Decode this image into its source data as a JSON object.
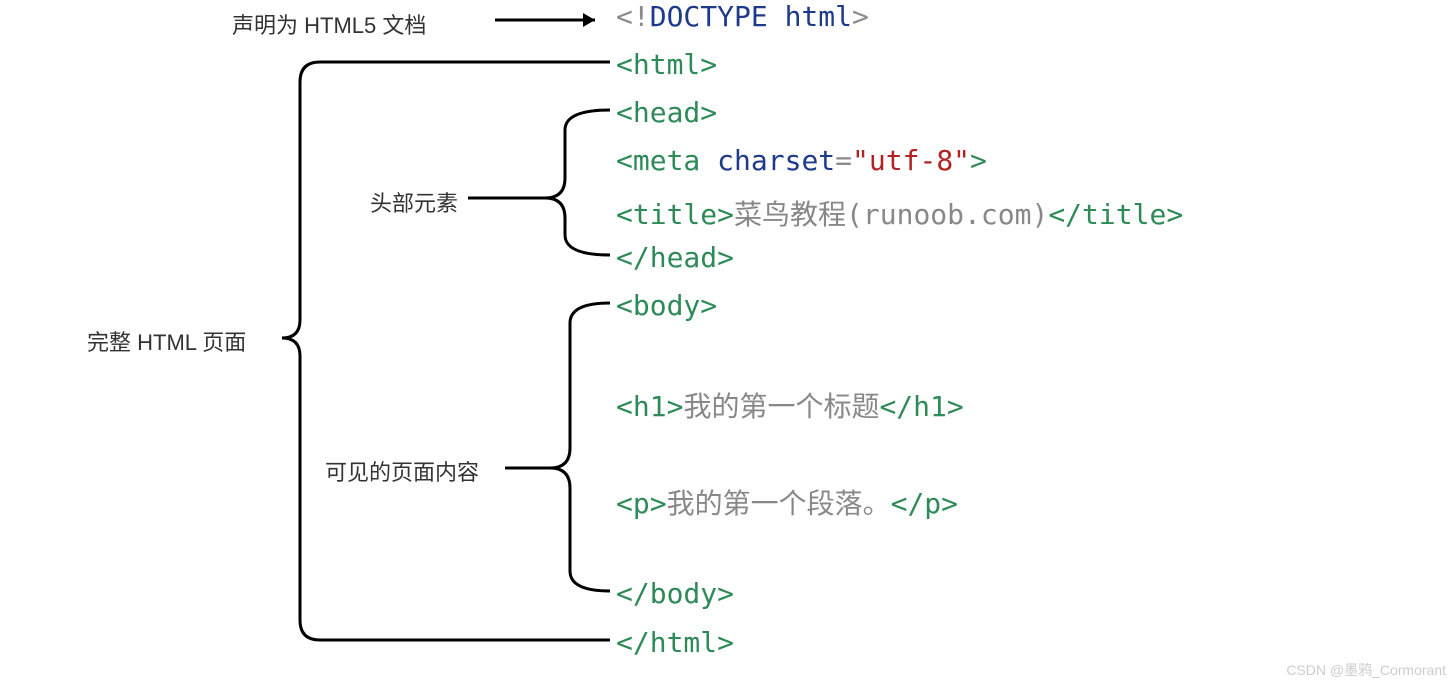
{
  "labels": {
    "doctype": "声明为 HTML5 文档",
    "fullPage": "完整 HTML 页面",
    "headSection": "头部元素",
    "bodySection": "可见的页面内容"
  },
  "code": {
    "doctype": {
      "open": "<",
      "bang": "!",
      "kw": "DOCTYPE html",
      "close": ">"
    },
    "htmlOpen": "<html>",
    "headOpen": "<head>",
    "meta": {
      "open": "<meta ",
      "attrName": "charset",
      "eq": "=",
      "attrVal": "\"utf-8\"",
      "close": ">"
    },
    "title": {
      "open": "<title>",
      "text": "菜鸟教程(runoob.com)",
      "close": "</title>"
    },
    "headClose": "</head>",
    "bodyOpen": "<body>",
    "h1": {
      "open": "<h1>",
      "text": "我的第一个标题",
      "close": "</h1>"
    },
    "p": {
      "open": "<p>",
      "text": "我的第一个段落。",
      "close": "</p>"
    },
    "bodyClose": "</body>",
    "htmlClose": "</html>"
  },
  "watermark": "CSDN @墨鸦_Cormorant"
}
